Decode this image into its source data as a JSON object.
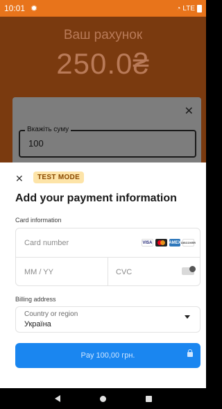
{
  "status": {
    "time": "10:01",
    "signal": "LTE"
  },
  "app": {
    "title": "Ваш рахунок",
    "balance": "250.0₴",
    "dialog": {
      "amount_label": "Вкажіть суму",
      "amount_value": "100"
    }
  },
  "sheet": {
    "test_badge": "TEST MODE",
    "title": "Add your payment information",
    "card_info_label": "Card information",
    "card_number_placeholder": "Card number",
    "expiry_placeholder": "MM / YY",
    "cvc_placeholder": "CVC",
    "brands": [
      "VISA",
      "",
      "AMEX",
      "DISCOVER"
    ],
    "billing_label": "Billing address",
    "country_label": "Country or region",
    "country_value": "Україна",
    "pay_label": "Pay 100,00 грн."
  }
}
